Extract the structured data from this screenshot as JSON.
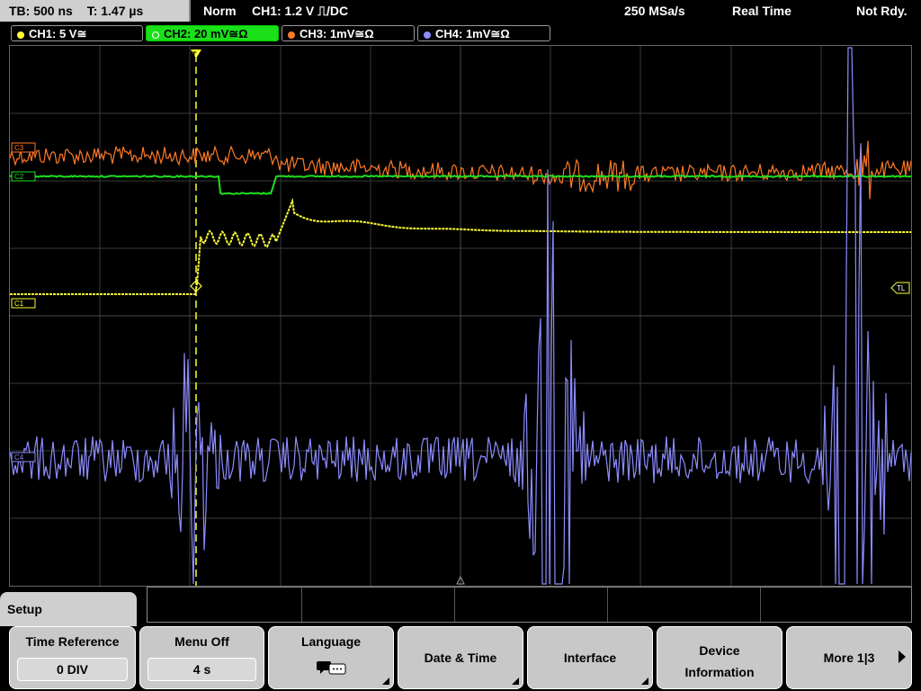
{
  "status_bar": {
    "timebase": "TB: 500 ns",
    "trigger_time": "T: 1.47 µs",
    "trigger_mode": "Norm",
    "trigger_info": "CH1: 1.2 V ⎍/DC",
    "sample_rate": "250 MSa/s",
    "acq_mode": "Real Time",
    "acq_state": "Not Rdy."
  },
  "channels": [
    {
      "label": "CH1: 5 V≅",
      "color": "#ffff33"
    },
    {
      "label": "CH2: 20 mV≅Ω",
      "color": "#1ee01e"
    },
    {
      "label": "CH3: 1mV≅Ω",
      "color": "#ff7a26"
    },
    {
      "label": "CH4: 1mV≅Ω",
      "color": "#8c8cff"
    }
  ],
  "markers": {
    "c3": "C3",
    "c2": "C2",
    "c1": "C1",
    "c4": "C4",
    "trigger_level": "TL",
    "trigger_pos": "T"
  },
  "setup_tab": "Setup",
  "softkeys": {
    "time_reference": {
      "label": "Time Reference",
      "value": "0 DIV"
    },
    "menu_off": {
      "label": "Menu Off",
      "value": "4 s"
    },
    "language": {
      "label": "Language",
      "icon": "speech-bubbles-icon"
    },
    "date_time": {
      "label": "Date & Time"
    },
    "interface": {
      "label": "Interface"
    },
    "device_info": {
      "label1": "Device",
      "label2": "Information"
    },
    "more": {
      "label": "More 1|3"
    }
  }
}
